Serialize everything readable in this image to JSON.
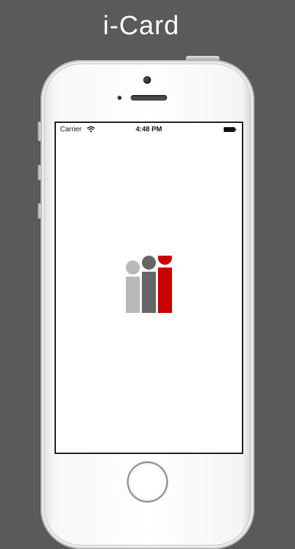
{
  "caption": "i-Card",
  "status_bar": {
    "carrier": "Carrier",
    "time": "4:48 PM"
  },
  "icons": {
    "wifi": "wifi-icon",
    "battery": "battery-icon",
    "logo": "i-card-people-logo"
  },
  "colors": {
    "background": "#5a5a5a",
    "logo_light": "#b9b9b9",
    "logo_dark": "#666666",
    "logo_red": "#cc0000"
  }
}
